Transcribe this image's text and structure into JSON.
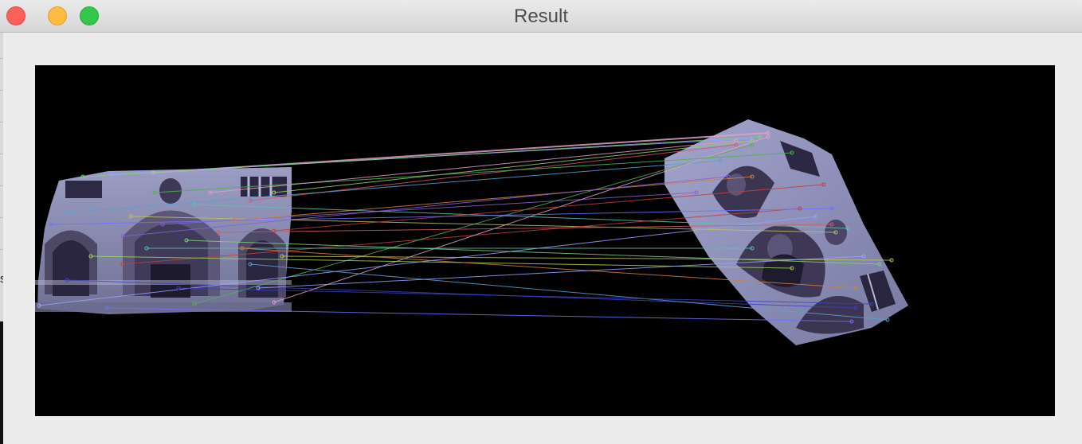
{
  "window": {
    "title": "Result",
    "controls": {
      "close": "close-button",
      "minimize": "minimize-button",
      "zoom": "zoom-button"
    }
  },
  "left_glyph": "s",
  "image": {
    "description_colors": {
      "background": "#000000",
      "facade_stone": "#8e8fb5",
      "facade_dark": "#3a3550",
      "roof_edge": "#ffd6f0"
    }
  }
}
